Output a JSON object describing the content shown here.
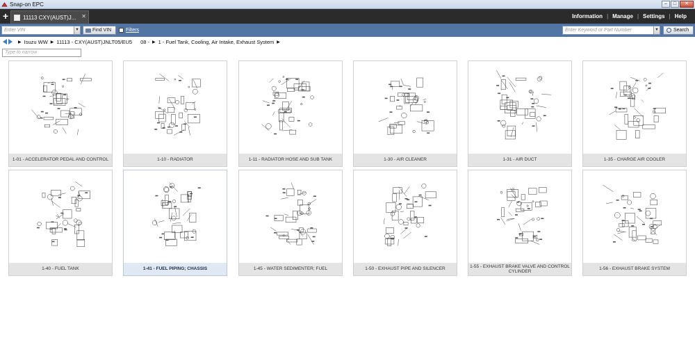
{
  "window": {
    "title": "Snap-on EPC"
  },
  "tab": {
    "label": "11113   CXY(AUST)J..."
  },
  "topnav": {
    "items": [
      "Information",
      "Manage",
      "Settings",
      "Help"
    ]
  },
  "search": {
    "vin_placeholder": "Enter VIN",
    "findvin_label": "Find VIN",
    "filters_label": "Filters",
    "keyword_placeholder": "Enter Keyword or Part Number",
    "search_label": "Search"
  },
  "breadcrumb": {
    "make": "Isuzu WW",
    "model": "11113 - CXY(AUST)JNLT05/EU5",
    "group_num": "08 -",
    "section": "1 - Fuel Tank, Cooling, Air Intake, Exhaust System"
  },
  "narrow": {
    "placeholder": "Type to narrow"
  },
  "cards": [
    {
      "caption": "1-01 - ACCELERATOR PEDAL AND CONTROL",
      "selected": false
    },
    {
      "caption": "1-10 - RADIATOR",
      "selected": false
    },
    {
      "caption": "1-11 - RADIATOR HOSE AND SUB TANK",
      "selected": false
    },
    {
      "caption": "1-30 - AIR CLEANER",
      "selected": false
    },
    {
      "caption": "1-31 - AIR DUCT",
      "selected": false
    },
    {
      "caption": "1-35 - CHARGE AIR COOLER",
      "selected": false
    },
    {
      "caption": "1-40 - FUEL TANK",
      "selected": false
    },
    {
      "caption": "1-41 - FUEL PIPING; CHASSIS",
      "selected": true
    },
    {
      "caption": "1-45 - WATER SEDIMENTER; FUEL",
      "selected": false
    },
    {
      "caption": "1-50 - EXHAUST PIPE AND SILENCER",
      "selected": false
    },
    {
      "caption": "1-55 - EXHAUST BRAKE VALVE AND CONTROL CYLINDER",
      "selected": false
    },
    {
      "caption": "1-56 - EXHAUST BRAKE SYSTEM",
      "selected": false
    }
  ],
  "colors": {
    "tabbar": "#2b2b2b",
    "searchbar": "#5275a3",
    "caption_bg": "#e4e4e4",
    "selected_caption_bg": "#dfe8f3"
  }
}
